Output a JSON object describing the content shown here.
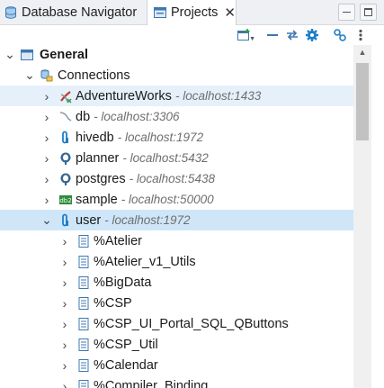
{
  "tabs": [
    {
      "label": "Database Navigator",
      "icon": "database-navigator-icon",
      "active": false
    },
    {
      "label": "Projects",
      "icon": "projects-icon",
      "active": true,
      "close": "✕"
    }
  ],
  "window_buttons": [
    "minimize",
    "maximize"
  ],
  "toolbar": [
    "new-connection-icon",
    "collapse-all-icon",
    "link-with-editor-icon",
    "configure-icon",
    "connect-icon",
    "view-menu-icon"
  ],
  "tree": {
    "project": "General",
    "folder": "Connections",
    "connections": [
      {
        "name": "AdventureWorks",
        "host": "- localhost:1433",
        "icon": "sqlserver-icon",
        "state": "hover"
      },
      {
        "name": "db",
        "host": "- localhost:3306",
        "icon": "mysql-icon"
      },
      {
        "name": "hivedb",
        "host": "- localhost:1972",
        "icon": "intersystems-icon"
      },
      {
        "name": "planner",
        "host": "- localhost:5432",
        "icon": "postgres-icon"
      },
      {
        "name": "postgres",
        "host": "- localhost:5438",
        "icon": "postgres-icon"
      },
      {
        "name": "sample",
        "host": "- localhost:50000",
        "icon": "db2-icon"
      },
      {
        "name": "user",
        "host": "- localhost:1972",
        "icon": "intersystems-icon",
        "state": "selected",
        "expanded": true
      }
    ],
    "schemas": [
      "%Atelier",
      "%Atelier_v1_Utils",
      "%BigData",
      "%CSP",
      "%CSP_UI_Portal_SQL_QButtons",
      "%CSP_Util",
      "%Calendar",
      "%Compiler_Binding"
    ]
  },
  "colors": {
    "selection": "#cfe6f9",
    "hover": "#e6f0fa",
    "accent": "#1d7fc9"
  }
}
